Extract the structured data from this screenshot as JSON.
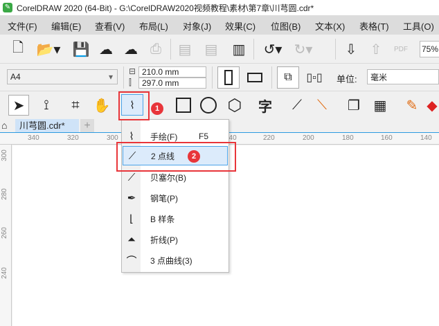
{
  "title": "CorelDRAW 2020 (64-Bit) - G:\\CorelDRAW2020视频教程\\素材\\第7章\\川芎圆.cdr*",
  "menu": [
    "文件(F)",
    "编辑(E)",
    "查看(V)",
    "布局(L)",
    "对象(J)",
    "效果(C)",
    "位图(B)",
    "文本(X)",
    "表格(T)",
    "工具(O)"
  ],
  "zoom": "75%",
  "property": {
    "page_size": "A4",
    "width": "210.0 mm",
    "height": "297.0 mm",
    "units_label": "单位:",
    "units": "毫米"
  },
  "tab": {
    "name": "川芎圆.cdr*",
    "add": "+"
  },
  "ruler_h": [
    "340",
    "320",
    "300",
    "240",
    "220",
    "200",
    "180",
    "160",
    "140"
  ],
  "ruler_v": [
    "300",
    "280",
    "260",
    "240"
  ],
  "flyout": [
    {
      "label": "手绘(F)",
      "shortcut": "F5",
      "icon": "freehand-icon"
    },
    {
      "label": "2 点线",
      "icon": "two-point-line-icon"
    },
    {
      "label": "贝塞尔(B)",
      "icon": "bezier-icon"
    },
    {
      "label": "钢笔(P)",
      "icon": "pen-icon"
    },
    {
      "label": "B 样条",
      "icon": "b-spline-icon"
    },
    {
      "label": "折线(P)",
      "icon": "polyline-icon"
    },
    {
      "label": "3 点曲线(3)",
      "icon": "three-point-curve-icon"
    }
  ],
  "badges": [
    "1",
    "2"
  ],
  "colors": {
    "accent": "#2b9ae0",
    "highlight": "#e8353a"
  }
}
